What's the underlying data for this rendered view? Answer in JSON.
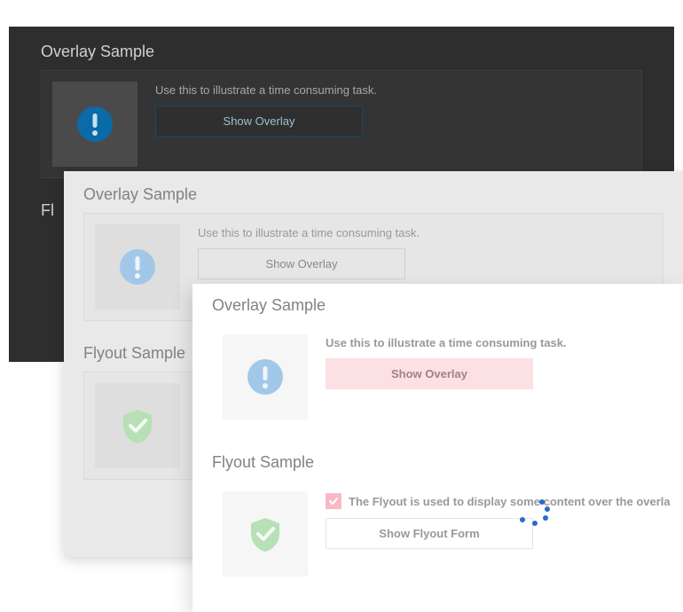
{
  "dark": {
    "overlay": {
      "title": "Overlay Sample",
      "desc": "Use this to illustrate a time consuming task.",
      "button": "Show Overlay"
    },
    "flyout": {
      "title_partial": "Fl"
    }
  },
  "gray": {
    "overlay": {
      "title": "Overlay Sample",
      "desc": "Use this to illustrate a time consuming task.",
      "button": "Show Overlay"
    },
    "flyout": {
      "title": "Flyout Sample"
    }
  },
  "white": {
    "overlay": {
      "title": "Overlay Sample",
      "desc": "Use this to illustrate a time consuming task.",
      "button": "Show Overlay"
    },
    "flyout": {
      "title": "Flyout Sample",
      "check_label": "The Flyout is used to display some content over the overla",
      "button": "Show Flyout Form"
    }
  }
}
